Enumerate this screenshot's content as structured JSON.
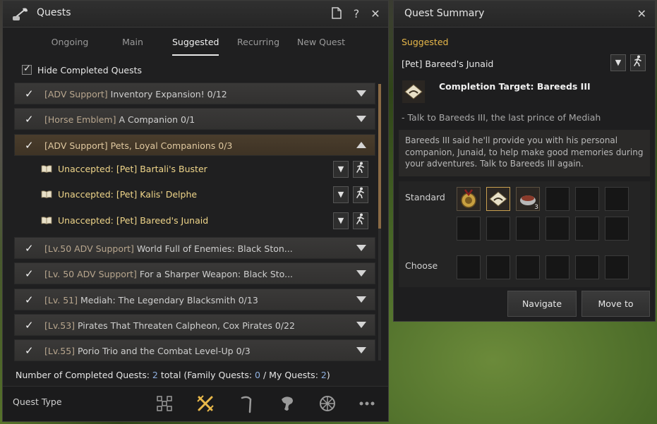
{
  "quests_window": {
    "title": "Quests",
    "tabs": [
      "Ongoing",
      "Main",
      "Suggested",
      "Recurring",
      "New Quest"
    ],
    "active_tab": "Suggested",
    "hide_completed_label": "Hide Completed Quests",
    "hide_completed_checked": true,
    "quests": [
      {
        "bracket": "[ADV Support]",
        "text": " Inventory Expansion! 0/12"
      },
      {
        "bracket": "[Horse Emblem]",
        "text": " A Companion 0/1"
      },
      {
        "bracket": "[ADV Support]",
        "text": " Pets, Loyal Companions 0/3"
      },
      {
        "bracket": "[Lv.50 ADV Support]",
        "text": " World Full of Enemies: Black Ston..."
      },
      {
        "bracket": "[Lv. 50 ADV Support]",
        "text": " For a Sharper Weapon: Black Sto..."
      },
      {
        "bracket": "[Lv. 51]",
        "text": " Mediah: The Legendary Blacksmith 0/13"
      },
      {
        "bracket": "[Lv.53]",
        "text": " Pirates That Threaten Calpheon, Cox Pirates 0/22"
      },
      {
        "bracket": "[Lv.55]",
        "text": " Porio Trio and the Combat Level-Up 0/3"
      }
    ],
    "sub_quests": [
      "Unaccepted: [Pet] Bartali's Buster",
      "Unaccepted: [Pet] Kalis' Delphe",
      "Unaccepted: [Pet] Bareed's Junaid"
    ],
    "completed_count": {
      "prefix": "Number of Completed Quests: ",
      "total": "2",
      "mid1": " total (Family Quests: ",
      "family": "0",
      "mid2": " / My Quests: ",
      "my": "2",
      "suffix": ")"
    },
    "quest_type_label": "Quest Type",
    "quest_type_icons": [
      "grid-icon",
      "crossed-swords-icon",
      "pickaxe-icon",
      "seahorse-icon",
      "wheel-icon",
      "more-icon"
    ]
  },
  "summary_window": {
    "title": "Quest Summary",
    "section_label": "Suggested",
    "quest_title": "[Pet] Bareed's Junaid",
    "completion_target": "Completion Target: Bareeds III",
    "target_desc": "- Talk to Bareeds III, the last prince of Mediah",
    "story": "Bareeds III said he'll provide you with his personal companion, Junaid, to help make good memories during your adventures. Talk to Bareeds III again.",
    "standard_label": "Standard",
    "choose_label": "Choose",
    "reward_count": "3",
    "navigate_label": "Navigate",
    "move_to_label": "Move to"
  },
  "colors": {
    "accent_gold": "#e8b84a",
    "subquest_yellow": "#f0d68a",
    "count_blue": "#8fb0e0"
  }
}
